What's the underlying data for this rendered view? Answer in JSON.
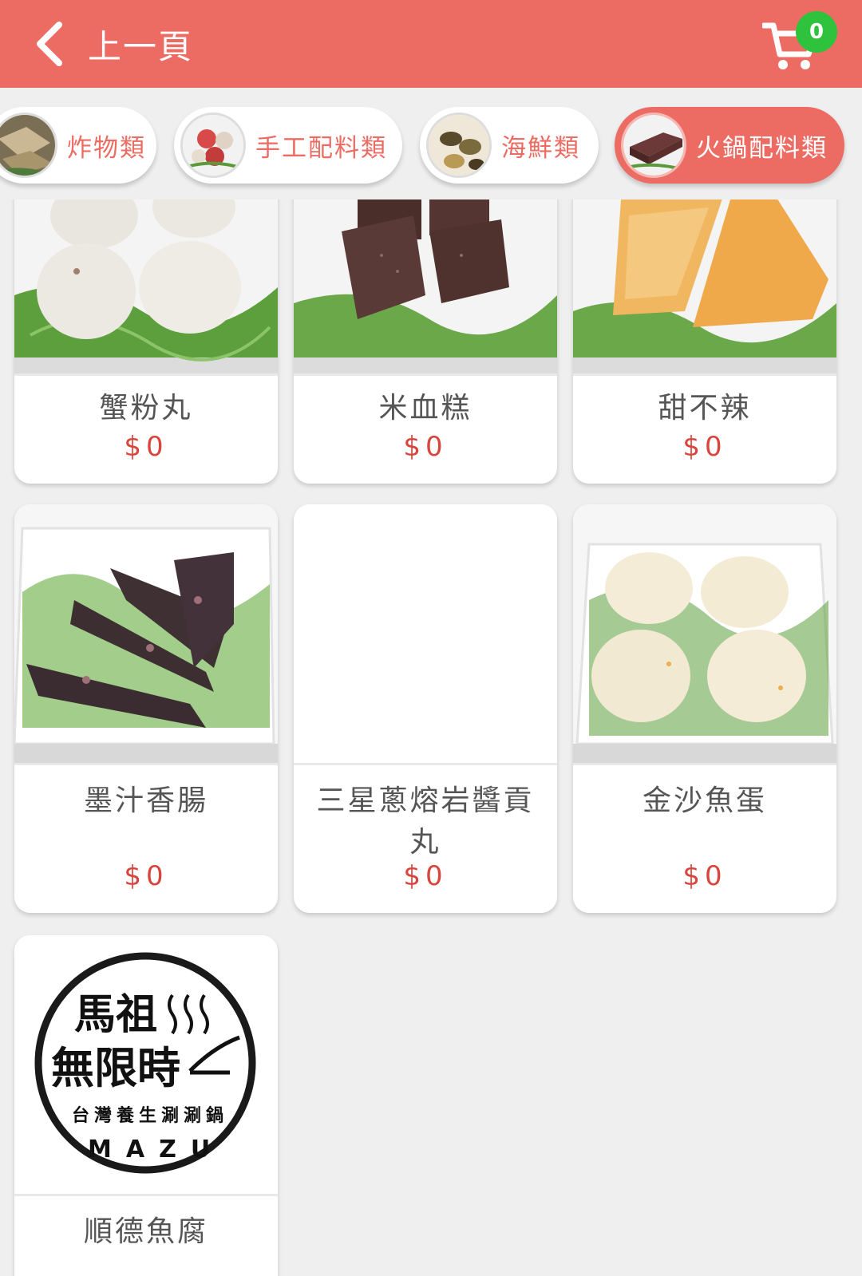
{
  "header": {
    "back_label": "上一頁",
    "cart_count": "0"
  },
  "colors": {
    "brand": "#ec6b62",
    "badge": "#2fc23c",
    "price": "#d9453c"
  },
  "tabs": [
    {
      "label": "炸物類",
      "thumb": "fried-food-photo",
      "active": false
    },
    {
      "label": "手工配料類",
      "thumb": "handmade-balls-photo",
      "active": false
    },
    {
      "label": "海鮮類",
      "thumb": "seafood-photo",
      "active": false
    },
    {
      "label": "火鍋配料類",
      "thumb": "hotpot-ingredients-photo",
      "active": true
    }
  ],
  "products": [
    {
      "name": "蟹粉丸",
      "price": "$0",
      "image": "crab-ball-photo"
    },
    {
      "name": "米血糕",
      "price": "$0",
      "image": "rice-blood-cake-photo"
    },
    {
      "name": "甜不辣",
      "price": "$0",
      "image": "tempura-photo"
    },
    {
      "name": "墨汁香腸",
      "price": "$0",
      "image": "squid-ink-sausage-photo"
    },
    {
      "name": "三星蔥熔岩醬貢丸",
      "price": "$0",
      "image": ""
    },
    {
      "name": "金沙魚蛋",
      "price": "$0",
      "image": "golden-fish-egg-photo"
    },
    {
      "name": "順德魚腐",
      "price": "",
      "image": "mazu-logo"
    }
  ],
  "logo": {
    "line1": "馬祖",
    "line2": "無限時",
    "line3": "台灣養生涮涮鍋",
    "line4": "MAZU"
  }
}
